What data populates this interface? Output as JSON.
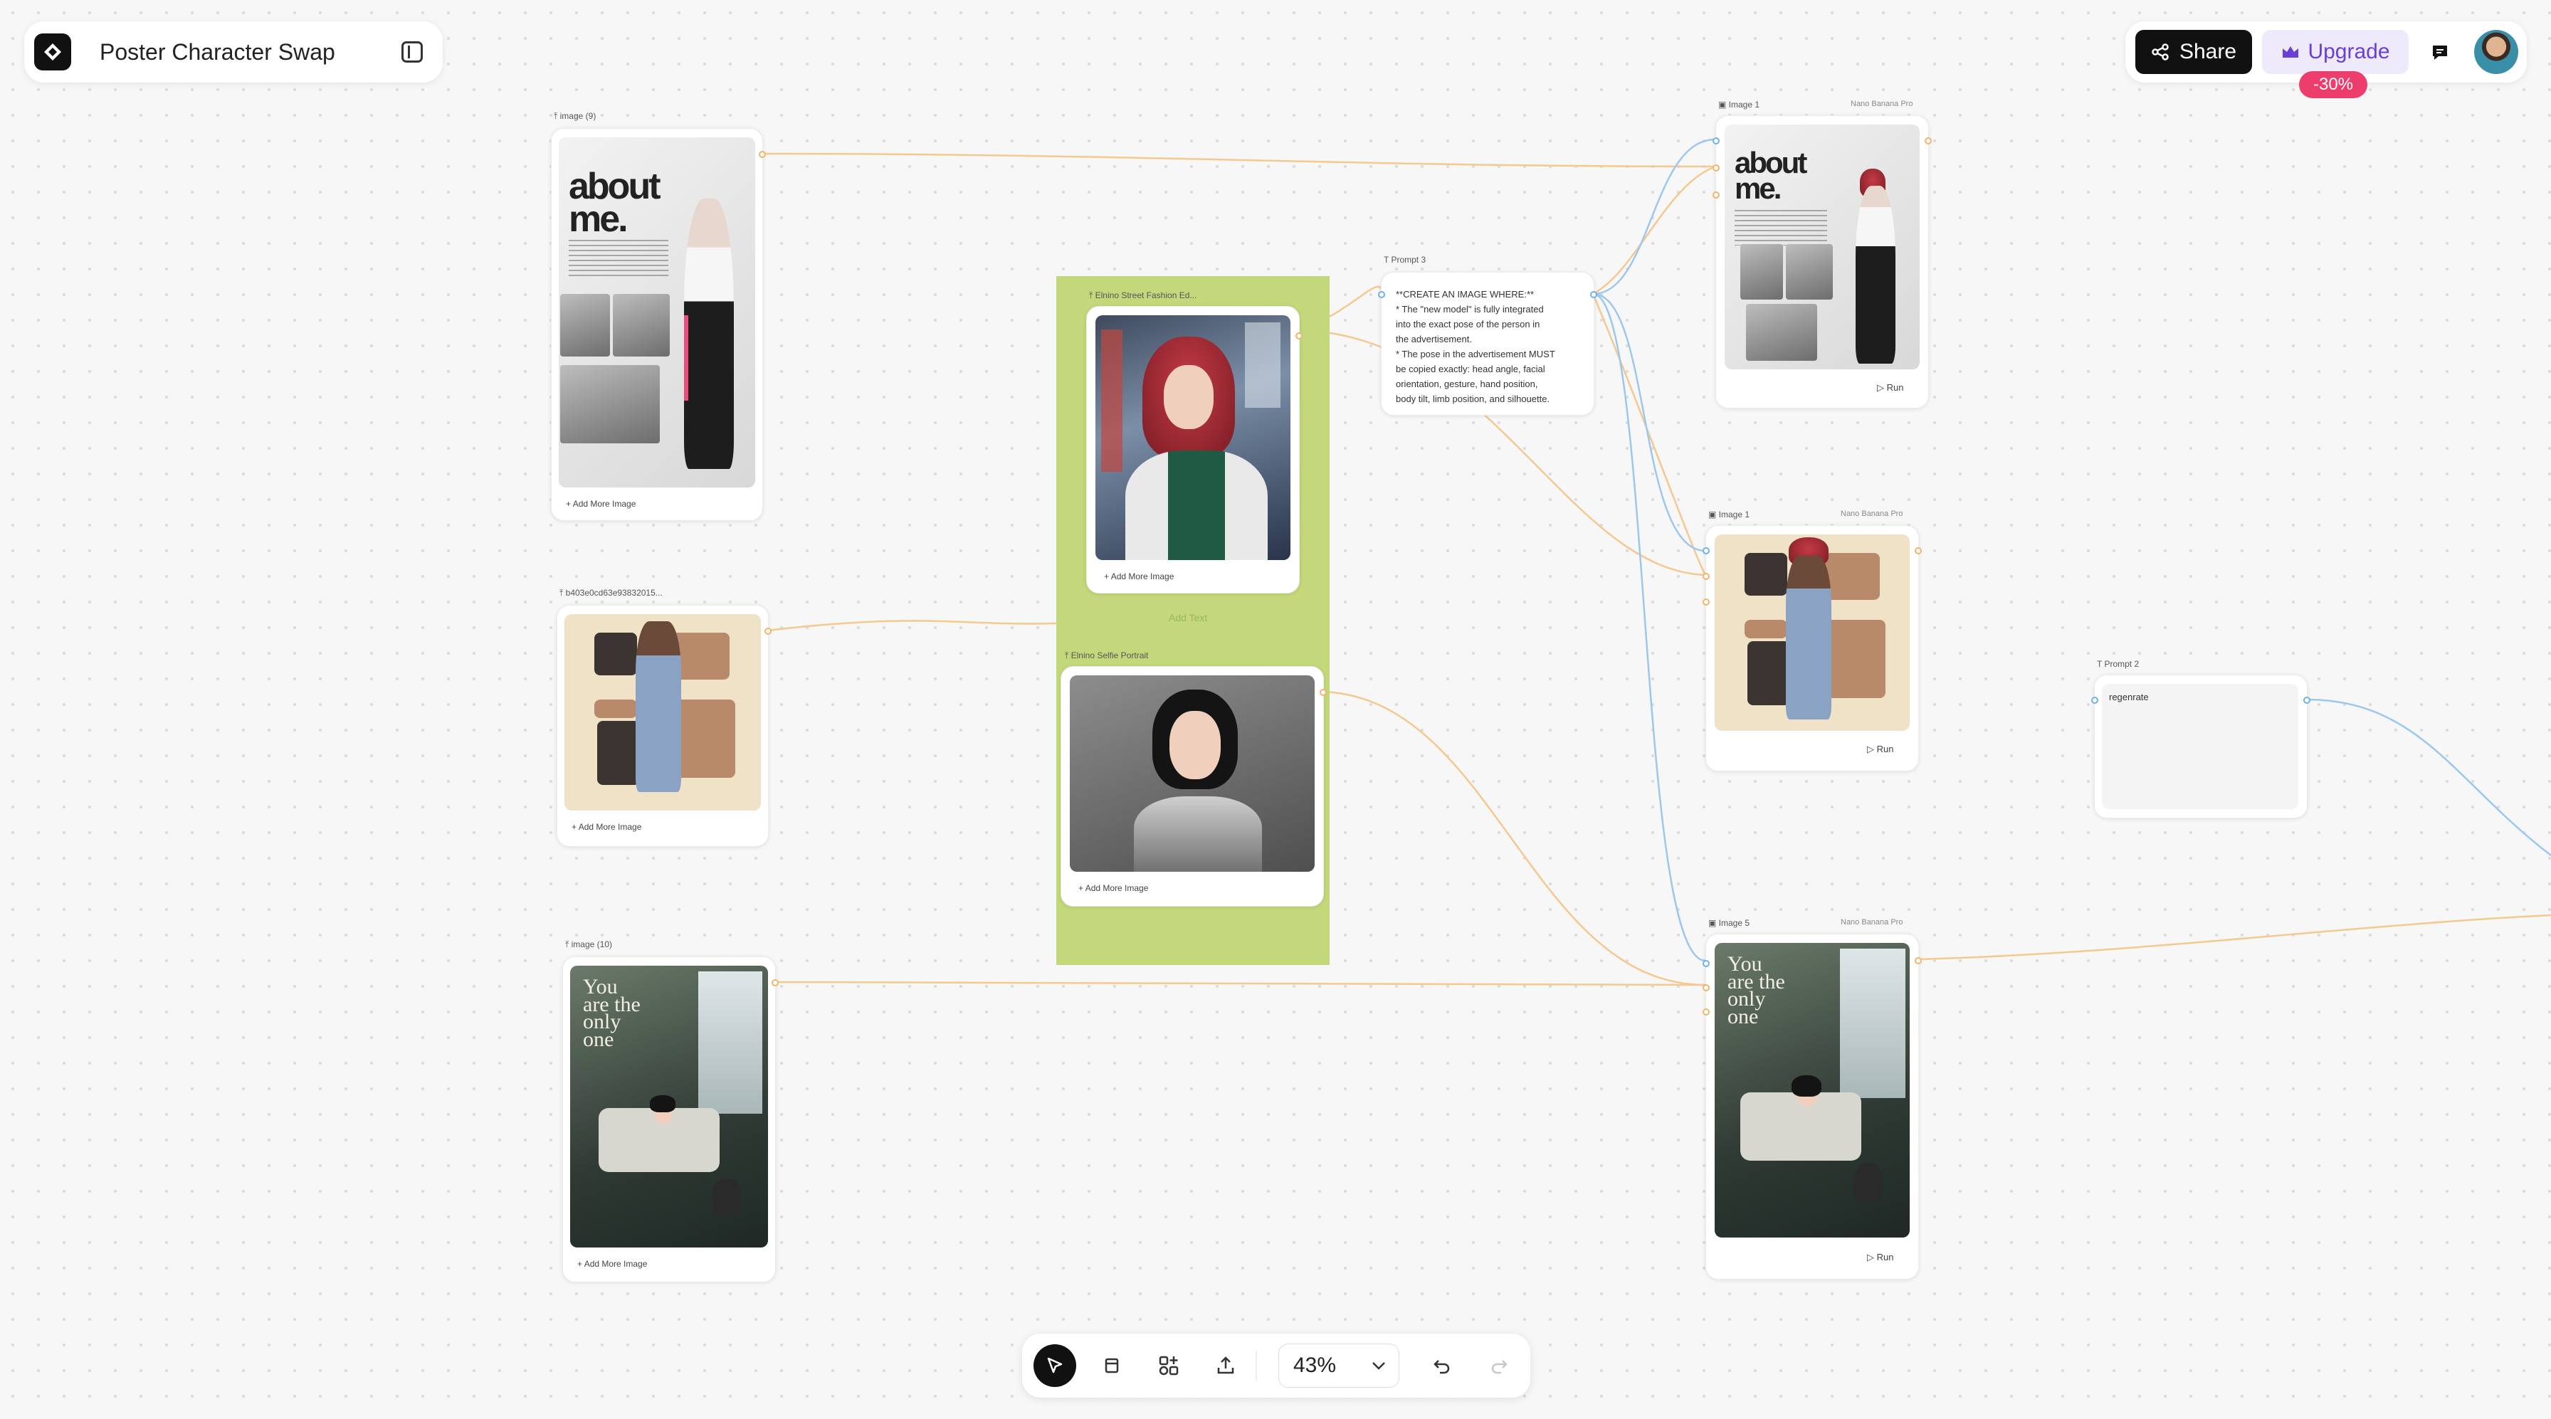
{
  "header": {
    "doc_title": "Poster Character Swap",
    "share_label": "Share",
    "upgrade_label": "Upgrade",
    "discount_badge": "-30%"
  },
  "poster_text": {
    "about_me": "about me.",
    "you_are_the_only_one": "You are the only one"
  },
  "nodes": {
    "image9": {
      "label": "image (9)",
      "add_more": "Add More Image"
    },
    "hashimg": {
      "label": "b403e0cd63e93832015...",
      "add_more": "Add More Image"
    },
    "image10": {
      "label": "image (10)",
      "add_more": "Add More Image"
    },
    "street": {
      "label": "Elnino Street Fashion Ed...",
      "add_more": "Add More Image"
    },
    "selfie": {
      "label": "Elnino Selfie Portrait",
      "add_more": "Add More Image"
    },
    "group": {
      "add_text": "Add Text"
    },
    "prompt3": {
      "label": "Prompt 3",
      "lines": [
        "**CREATE AN IMAGE WHERE:**",
        "* The \"new model\" is fully integrated",
        "into the exact pose of the person in",
        "the advertisement.",
        "* The pose in the advertisement MUST",
        "be copied exactly: head angle, facial",
        "orientation, gesture, hand position,",
        "body tilt, limb position, and silhouette."
      ]
    },
    "out1": {
      "label": "Image 1",
      "model": "Nano Banana Pro",
      "run": "Run"
    },
    "out2": {
      "label": "Image 1",
      "model": "Nano Banana Pro",
      "run": "Run"
    },
    "out5": {
      "label": "Image 5",
      "model": "Nano Banana Pro",
      "run": "Run"
    },
    "prompt2": {
      "label": "Prompt 2",
      "text": "regenrate"
    }
  },
  "toolbar": {
    "zoom": "43%"
  },
  "colors": {
    "accent_orange": "#f3b46a",
    "accent_blue": "#6fb1ea",
    "group_green": "#c3d87b",
    "upgrade_purple": "#6a3fd6",
    "badge_pink": "#ec3d6c"
  }
}
